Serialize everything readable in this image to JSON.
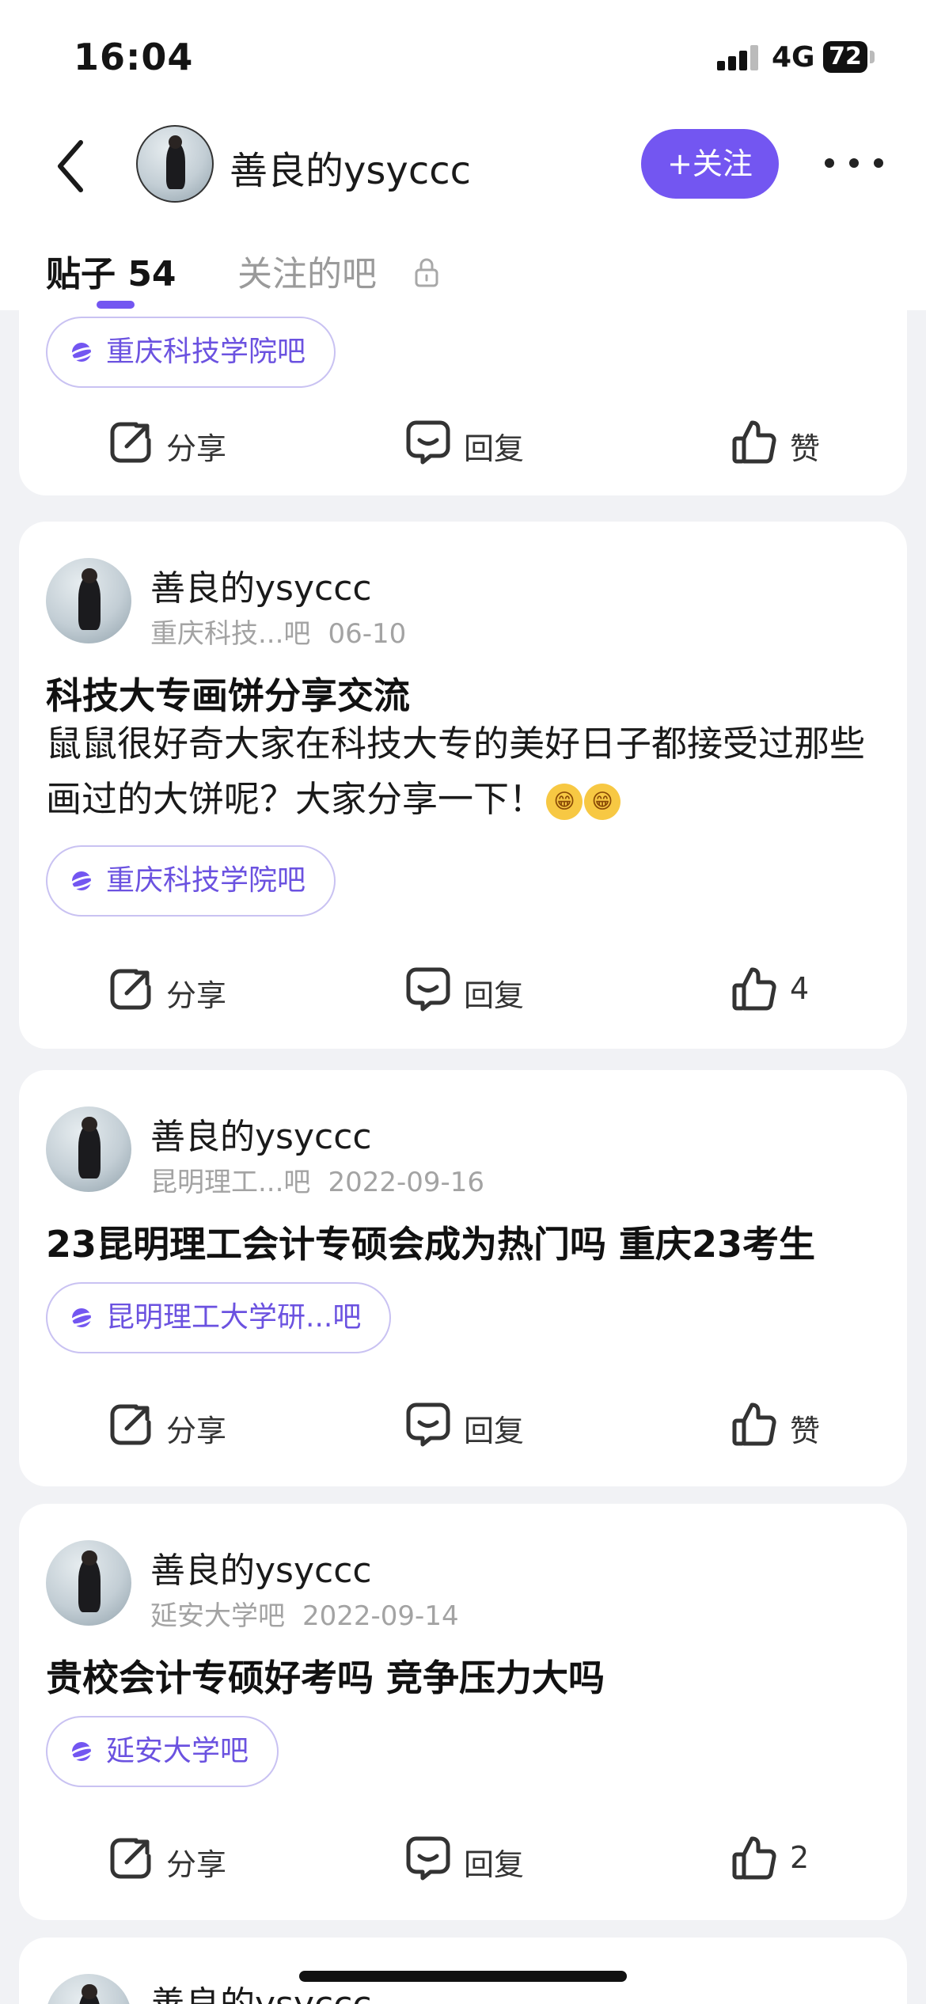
{
  "status_bar": {
    "time": "16:04",
    "network": "4G",
    "battery": "72"
  },
  "nav": {
    "username": "善良的ysyccc",
    "follow_label": "+关注"
  },
  "tabs": [
    {
      "label": "贴子 54",
      "active": true
    },
    {
      "label": "关注的吧",
      "active": false,
      "locked": true
    }
  ],
  "icons": {
    "back": "chevron-left-icon",
    "more": "more-dots-icon",
    "lock": "lock-icon",
    "share": "share-icon",
    "reply": "comment-icon",
    "like": "thumbs-up-icon",
    "bar": "planet-icon"
  },
  "colors": {
    "accent": "#7356f1",
    "tag_text": "#6b52e0",
    "tag_border": "#c9c2f2",
    "background": "#f1f2f5"
  },
  "action_labels": {
    "share": "分享",
    "reply": "回复"
  },
  "posts": [
    {
      "tag": "重庆科技学院吧",
      "like": "赞"
    },
    {
      "author": "善良的ysyccc",
      "bar": "重庆科技...吧",
      "date": "06-10",
      "title": "科技大专画饼分享交流",
      "body": "鼠鼠很好奇大家在科技大专的美好日子都接受过那些画过的大饼呢？大家分享一下！",
      "emoji": [
        "😁",
        "😁"
      ],
      "tag": "重庆科技学院吧",
      "like": "4"
    },
    {
      "author": "善良的ysyccc",
      "bar": "昆明理工...吧",
      "date": "2022-09-16",
      "title": "23昆明理工会计专硕会成为热门吗 重庆23考生",
      "tag": "昆明理工大学研...吧",
      "like": "赞"
    },
    {
      "author": "善良的ysyccc",
      "bar": "延安大学吧",
      "date": "2022-09-14",
      "title": "贵校会计专硕好考吗 竞争压力大吗",
      "tag": "延安大学吧",
      "like": "2"
    },
    {
      "author": "善良的ysyccc"
    }
  ]
}
